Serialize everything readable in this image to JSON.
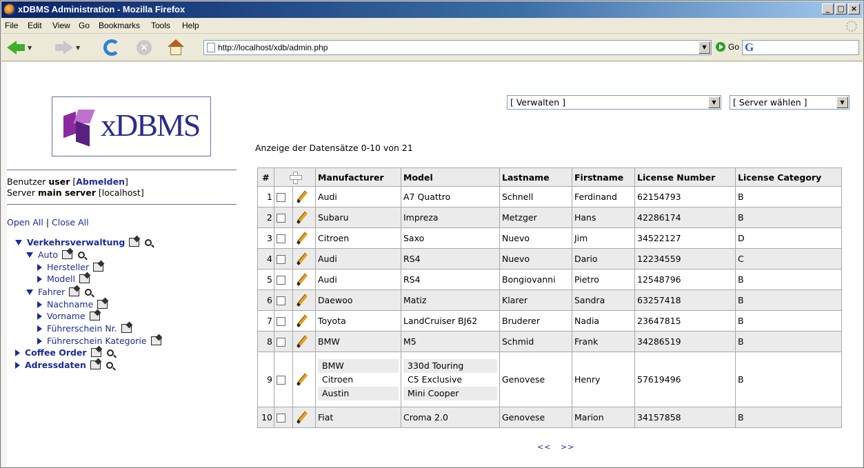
{
  "window": {
    "title": "xDBMS Administration - Mozilla Firefox",
    "controls": [
      "_",
      "□",
      "×"
    ]
  },
  "menu": [
    "File",
    "Edit",
    "View",
    "Go",
    "Bookmarks",
    "Tools",
    "Help"
  ],
  "navigation": {
    "url": "http://localhost/xdb/admin.php",
    "go_label": "Go",
    "search_icon": "G"
  },
  "logo": {
    "text": "xDBMS"
  },
  "session": {
    "user_prefix": "Benutzer",
    "user": "user",
    "logout": "Abmelden",
    "server_prefix": "Server",
    "server": "main server",
    "host": "[localhost]"
  },
  "tree_controls": {
    "open_all": "Open All",
    "separator": "|",
    "close_all": "Close All"
  },
  "tree": {
    "root": "Verkehrsverwaltung",
    "auto": "Auto",
    "hersteller": "Hersteller",
    "modell": "Modell",
    "fahrer": "Fahrer",
    "nachname": "Nachname",
    "vorname": "Vorname",
    "fs_nr": "Führerschein Nr.",
    "fs_kat": "Führerschein Kategorie",
    "coffee": "Coffee Order",
    "adress": "Adressdaten"
  },
  "selects": {
    "manage": "[ Verwalten ]",
    "server": "[ Server wählen ]"
  },
  "records_info": "Anzeige der Datensätze 0-10 von 21",
  "table": {
    "headers": [
      "#",
      "Manufacturer",
      "Model",
      "Lastname",
      "Firstname",
      "License Number",
      "License Category"
    ],
    "rows": [
      {
        "num": "1",
        "manufacturer": "Audi",
        "model": "A7 Quattro",
        "lastname": "Schnell",
        "firstname": "Ferdinand",
        "license": "62154793",
        "category": "B"
      },
      {
        "num": "2",
        "manufacturer": "Subaru",
        "model": "Impreza",
        "lastname": "Metzger",
        "firstname": "Hans",
        "license": "42286174",
        "category": "B"
      },
      {
        "num": "3",
        "manufacturer": "Citroen",
        "model": "Saxo",
        "lastname": "Nuevo",
        "firstname": "Jim",
        "license": "34522127",
        "category": "D"
      },
      {
        "num": "4",
        "manufacturer": "Audi",
        "model": "RS4",
        "lastname": "Nuevo",
        "firstname": "Dario",
        "license": "12234559",
        "category": "C"
      },
      {
        "num": "5",
        "manufacturer": "Audi",
        "model": "RS4",
        "lastname": "Bongiovanni",
        "firstname": "Pietro",
        "license": "12548796",
        "category": "B"
      },
      {
        "num": "6",
        "manufacturer": "Daewoo",
        "model": "Matiz",
        "lastname": "Klarer",
        "firstname": "Sandra",
        "license": "63257418",
        "category": "B"
      },
      {
        "num": "7",
        "manufacturer": "Toyota",
        "model": "LandCruiser BJ62",
        "lastname": "Bruderer",
        "firstname": "Nadia",
        "license": "23647815",
        "category": "B"
      },
      {
        "num": "8",
        "manufacturer": "BMW",
        "model": "M5",
        "lastname": "Schmid",
        "firstname": "Frank",
        "license": "34286519",
        "category": "B"
      },
      {
        "num": "9",
        "manufacturers": [
          "BMW",
          "Citroen",
          "Austin"
        ],
        "models": [
          "330d Touring",
          "C5 Exclusive",
          "Mini Cooper"
        ],
        "lastname": "Genovese",
        "firstname": "Henry",
        "license": "57619496",
        "category": "B"
      },
      {
        "num": "10",
        "manufacturer": "Fiat",
        "model": "Croma 2.0",
        "lastname": "Genovese",
        "firstname": "Marion",
        "license": "34157858",
        "category": "B"
      }
    ]
  },
  "pager": {
    "prev": "<<",
    "next": ">>"
  }
}
